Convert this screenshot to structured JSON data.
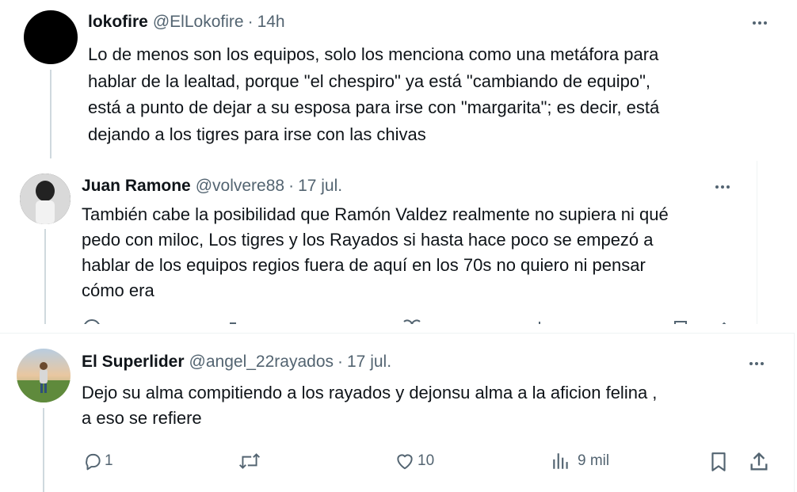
{
  "tweets": [
    {
      "name": "lokofire",
      "handle": "@ElLokofire",
      "time": "14h",
      "text": "Lo de menos son los equipos, solo los menciona como una metáfora para\nhablar de la lealtad, porque \"el chespiro\" ya está \"cambiando de equipo\",\nestá a punto de dejar a su esposa para irse con \"margarita\"; es decir, está\ndejando a los tigres para irse con  las chivas",
      "avatar_color": "#000000"
    },
    {
      "name": "Juan Ramone",
      "handle": "@volvere88",
      "time": "17 jul.",
      "text": "También cabe la posibilidad que Ramón Valdez realmente no supiera ni qué\npedo con miloc, Los tigres y los Rayados si hasta hace poco se empezó a\nhablar de los equipos regios fuera de aquí en los 70s no quiero ni pensar\ncómo era",
      "avatar_color": "#2a2a2a"
    },
    {
      "name": "El Superlider",
      "handle": "@angel_22rayados",
      "time": "17 jul.",
      "text": "Dejo su alma compitiendo a los rayados y dejonsu alma a la aficion felina ,\na eso se refiere",
      "avatar_color": "#5a7d3a",
      "actions": {
        "replies": "1",
        "reposts": "",
        "likes": "10",
        "views": "9 mil"
      }
    }
  ],
  "separator": "·",
  "icons": [
    "more-icon",
    "reply-icon",
    "repost-icon",
    "like-icon",
    "views-icon",
    "bookmark-icon",
    "share-icon"
  ],
  "colors": {
    "text": "#0f1419",
    "muted": "#536471",
    "line": "#cfd9de"
  }
}
